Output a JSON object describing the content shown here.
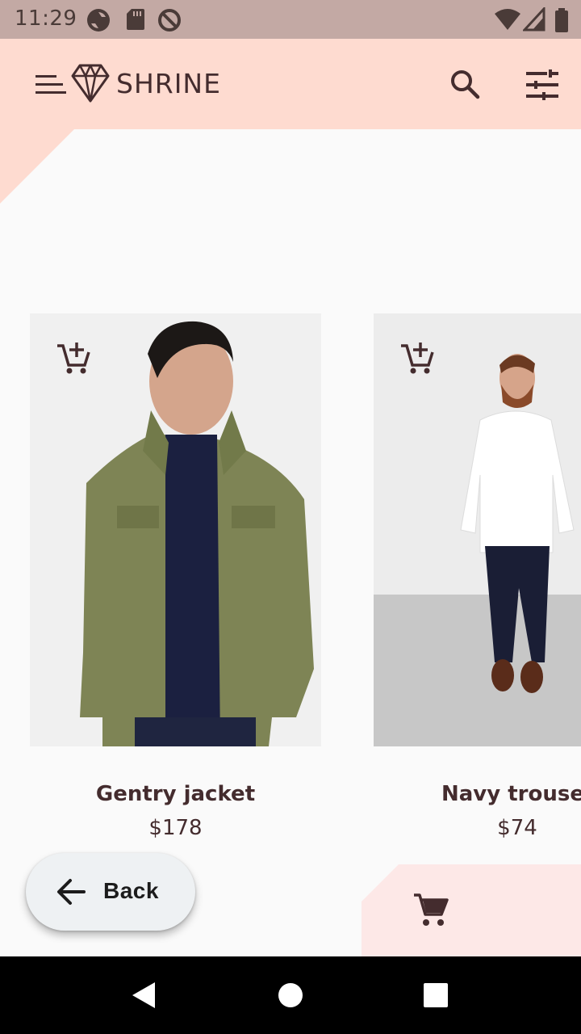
{
  "status_bar": {
    "time": "11:29",
    "icons": [
      "sync-icon",
      "sd-card-icon",
      "at-sign-icon",
      "wifi-icon",
      "cellular-signal-icon",
      "battery-icon"
    ]
  },
  "app_bar": {
    "title": "SHRINE",
    "menu_icon": "menu-icon",
    "logo_icon": "diamond-logo-icon",
    "search_icon": "search-icon",
    "filter_icon": "tune-icon"
  },
  "products": [
    {
      "name": "Gentry jacket",
      "price": "$178",
      "action_icon": "add-shopping-cart-icon"
    },
    {
      "name": "Navy trousers",
      "price": "$74",
      "action_icon": "add-shopping-cart-icon"
    }
  ],
  "back_button": {
    "label": "Back",
    "icon": "arrow-back-icon"
  },
  "cart": {
    "icon": "shopping-cart-icon"
  },
  "nav_bar": {
    "icons": [
      "nav-back-icon",
      "nav-home-icon",
      "nav-recents-icon"
    ]
  },
  "colors": {
    "app_bar": "#fedbd0",
    "status_bar": "#c3a9a4",
    "text": "#442c2e",
    "cart_sheet": "#fde8e7",
    "background": "#fafafa"
  }
}
